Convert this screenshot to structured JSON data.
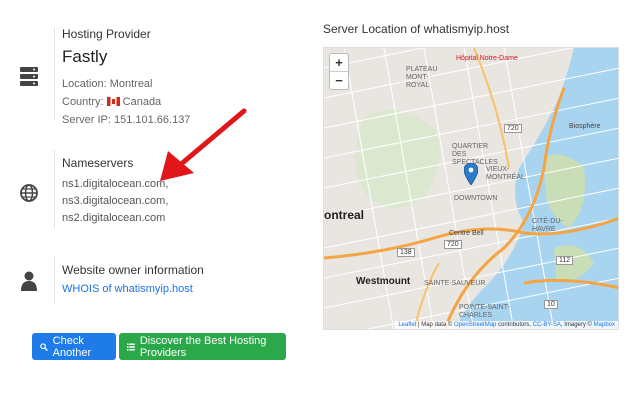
{
  "hosting": {
    "label": "Hosting Provider",
    "provider": "Fastly",
    "location": "Location: Montreal",
    "country_prefix": "Country:",
    "country": "Canada",
    "server_ip": "Server IP: 151.101.66.137"
  },
  "nameservers": {
    "label": "Nameservers",
    "items": [
      "ns1.digitalocean.com,",
      "ns3.digitalocean.com,",
      "ns2.digitalocean.com"
    ]
  },
  "owner": {
    "label": "Website owner information",
    "link": "WHOIS of whatismyip.host"
  },
  "buttons": {
    "check": "Check Another",
    "discover": "Discover the Best Hosting Providers"
  },
  "map": {
    "title": "Server Location of whatismyip.host",
    "zoom_in": "+",
    "zoom_out": "−",
    "labels": {
      "city1": "ontreal",
      "city2": "Westmount",
      "downtown": "DOWNTOWN",
      "quartier": "QUARTIER DES SPECTACLES",
      "vieux": "VIEUX-MONTRÉAL",
      "plateau": "PLATEAU MONT-ROYAL",
      "hopital": "Hôpital Notre-Dame",
      "biosphere": "Biosphère",
      "centre_bell": "Centre Bell",
      "saint_sauveur": "SAINTE-SAUVEUR",
      "pointe": "POINTE-SAINT-CHARLES",
      "cite": "CITÉ-DU-HAVRE",
      "r720a": "720",
      "r720b": "720",
      "r138": "138",
      "r112": "112",
      "r10": "10"
    },
    "attribution": {
      "leaflet": "Leaflet",
      "text1": "| Map data ©",
      "osm": "OpenStreetMap",
      "text2": "contributors,",
      "license": "CC-BY-SA",
      "text3": ", Imagery ©",
      "mapbox": "Mapbox"
    }
  },
  "icons": {
    "server": "server-icon",
    "globe": "globe-icon",
    "user": "user-icon",
    "search": "search-icon",
    "list": "list-icon",
    "marker": "map-marker-icon"
  },
  "colors": {
    "blue": "#1e7be8",
    "green": "#2aa84a",
    "arrow": "#e0161b",
    "water": "#a8d4f0"
  }
}
